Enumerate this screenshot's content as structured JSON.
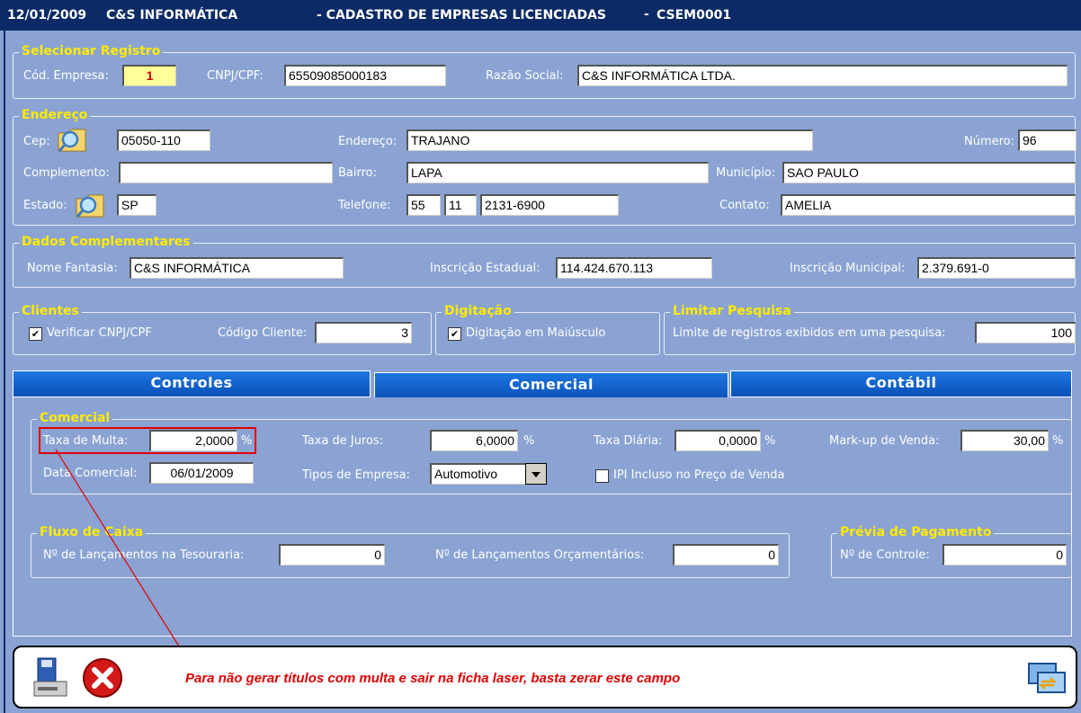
{
  "titlebar": {
    "date": "12/01/2009",
    "company": "C&S INFORMÁTICA",
    "screen": "- CADASTRO DE EMPRESAS LICENCIADAS",
    "code": "CSEM0001"
  },
  "selecionar": {
    "title": "Selecionar Registro",
    "cod_label": "Cód. Empresa:",
    "cod_value": "1",
    "cnpj_label": "CNPJ/CPF:",
    "cnpj_value": "65509085000183",
    "razao_label": "Razão Social:",
    "razao_value": "C&S INFORMÁTICA LTDA."
  },
  "endereco": {
    "title": "Endereço",
    "cep_label": "Cep:",
    "cep_value": "05050-110",
    "end_label": "Endereço:",
    "end_value": "TRAJANO",
    "num_label": "Número:",
    "num_value": "96",
    "comp_label": "Complemento:",
    "comp_value": "",
    "bairro_label": "Bairro:",
    "bairro_value": "LAPA",
    "mun_label": "Município:",
    "mun_value": "SAO PAULO",
    "estado_label": "Estado:",
    "estado_value": "SP",
    "tel_label": "Telefone:",
    "tel_ddi": "55",
    "tel_ddd": "11",
    "tel_num": "2131-6900",
    "contato_label": "Contato:",
    "contato_value": "AMELIA"
  },
  "complementares": {
    "title": "Dados Complementares",
    "fantasia_label": "Nome Fantasia:",
    "fantasia_value": "C&S INFORMÁTICA",
    "ie_label": "Inscrição Estadual:",
    "ie_value": "114.424.670.113",
    "im_label": "Inscrição Municipal:",
    "im_value": "2.379.691-0"
  },
  "clientes": {
    "title": "Clientes",
    "verificar_label": "Verificar CNPJ/CPF",
    "codigo_label": "Código Cliente:",
    "codigo_value": "3"
  },
  "digitacao": {
    "title": "Digitação",
    "maiusculo_label": "Digitação em Maiúsculo"
  },
  "limitar": {
    "title": "Limitar Pesquisa",
    "limite_label": "Limite de registros exibidos em uma pesquisa:",
    "limite_value": "100"
  },
  "tabs": [
    {
      "label": "Controles"
    },
    {
      "label": "Comercial"
    },
    {
      "label": "Contábil"
    }
  ],
  "comercial": {
    "title": "Comercial",
    "multa_label": "Taxa de Multa:",
    "multa_value": "2,0000",
    "juros_label": "Taxa de Juros:",
    "juros_value": "6,0000",
    "diaria_label": "Taxa Diária:",
    "diaria_value": "0,0000",
    "markup_label": "Mark-up de Venda:",
    "markup_value": "30,00",
    "pct": "%",
    "data_label": "Data Comercial:",
    "data_value": "06/01/2009",
    "tipos_label": "Tipos de Empresa:",
    "tipos_value": "Automotivo",
    "ipi_label": "IPI Incluso no Preço de Venda"
  },
  "fluxo": {
    "title": "Fluxo de Caixa",
    "tesouraria_label": "Nº de Lançamentos na Tesouraria:",
    "tesouraria_value": "0",
    "orcamentarios_label": "Nº de Lançamentos Orçamentários:",
    "orcamentarios_value": "0"
  },
  "previa": {
    "title": "Prévia de Pagamento",
    "controle_label": "Nº de Controle:",
    "controle_value": "0"
  },
  "annotation": {
    "message": "Para não gerar títulos com multa e sair na ficha laser, basta zerar este campo",
    "color": "#e00000"
  },
  "icons": {
    "save": "save-icon",
    "close": "close-icon",
    "switch": "switch-window-icon",
    "search": "magnifier-folder-icon"
  }
}
